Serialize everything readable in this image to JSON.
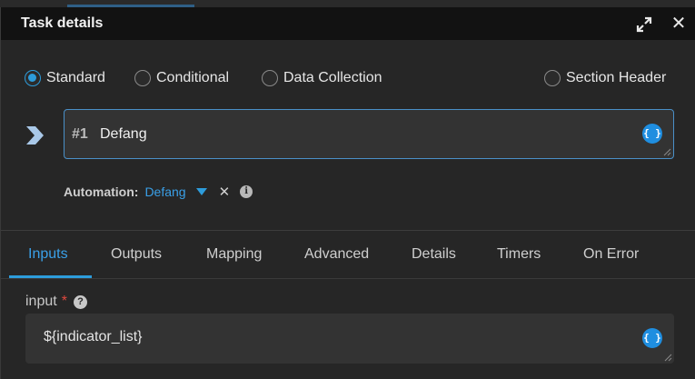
{
  "dialog": {
    "title": "Task details"
  },
  "task_type": {
    "options": [
      {
        "label": "Standard",
        "selected": true
      },
      {
        "label": "Conditional",
        "selected": false
      },
      {
        "label": "Data Collection",
        "selected": false
      },
      {
        "label": "Section Header",
        "selected": false
      }
    ]
  },
  "task": {
    "number": "#1",
    "name": "Defang",
    "variable_icon": "{ }"
  },
  "automation": {
    "label": "Automation:",
    "value": "Defang"
  },
  "tabs": [
    {
      "label": "Inputs",
      "active": true
    },
    {
      "label": "Outputs",
      "active": false
    },
    {
      "label": "Mapping",
      "active": false
    },
    {
      "label": "Advanced",
      "active": false
    },
    {
      "label": "Details",
      "active": false
    },
    {
      "label": "Timers",
      "active": false
    },
    {
      "label": "On Error",
      "active": false
    }
  ],
  "inputs": {
    "field_label": "input",
    "required_marker": "*",
    "help_glyph": "?",
    "value": "${indicator_list}",
    "variable_icon": "{ }"
  },
  "colors": {
    "accent": "#2d9cdb",
    "required": "#e0483e",
    "background": "#262626",
    "title_bar": "#121212"
  }
}
